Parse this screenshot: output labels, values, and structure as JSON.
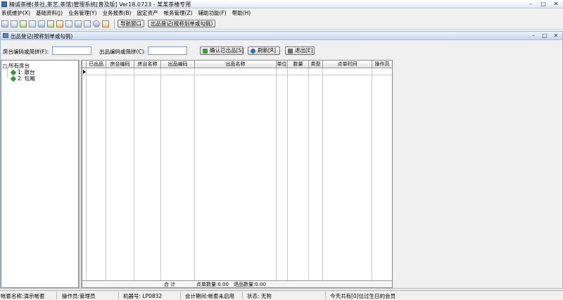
{
  "window": {
    "title": "精诚茶楼(茶社,茶艺,茶馆)管理系统[普及版] Ver18.0723 - 某某茶楼专用"
  },
  "menubar": {
    "items": [
      "系统维护(X)",
      "基础资料(J)",
      "业务管理(Y)",
      "业务报表(B)",
      "固定资产",
      "帐务管理(Z)",
      "辅助功能(F)",
      "帮助(H)"
    ]
  },
  "toolbar": {
    "icons": [
      "table-icon",
      "list-icon",
      "report-icon",
      "print-icon",
      "preview-icon",
      "user-icon",
      "edit-icon",
      "bookmark-icon",
      "save-icon",
      "printer-icon",
      "help-icon",
      "exit-icon"
    ],
    "nav_button": "导航窗口",
    "order_button": "出品登记(按称划单或勾挑)"
  },
  "child_window": {
    "title": "出品登记(按称划单或勾挑)",
    "filter": {
      "room_label": "房台编码或简拼(F):",
      "room_value": "",
      "item_label": "出品编码或简拼(C):",
      "item_value": "",
      "confirm_button": "确认已出品[S]",
      "refresh_button": "刷新[R]",
      "exit_button": "退出[E]"
    },
    "tree": {
      "root": "所有房台",
      "children": [
        "1: 散台",
        "2: 包厢"
      ]
    },
    "grid": {
      "columns": [
        "已出品",
        "房台编码",
        "房台名称",
        "出品编码",
        "出品名称",
        "单位",
        "数量",
        "类型",
        "点单时间",
        "操作员"
      ],
      "rows": [],
      "footer": {
        "total_label": "合    计",
        "order_qty_label": "点单数量:0.00",
        "return_qty_label": "退品数量:0.00"
      }
    }
  },
  "statusbar": {
    "account": "帐套名称:演示帐套",
    "operator": "操作员:管理员",
    "machine": "机器号: LP0832",
    "period": "会计期间:帐套未启用",
    "state": "状态: 无狗",
    "birthday": "今天共有[0]位过生日的会员"
  }
}
